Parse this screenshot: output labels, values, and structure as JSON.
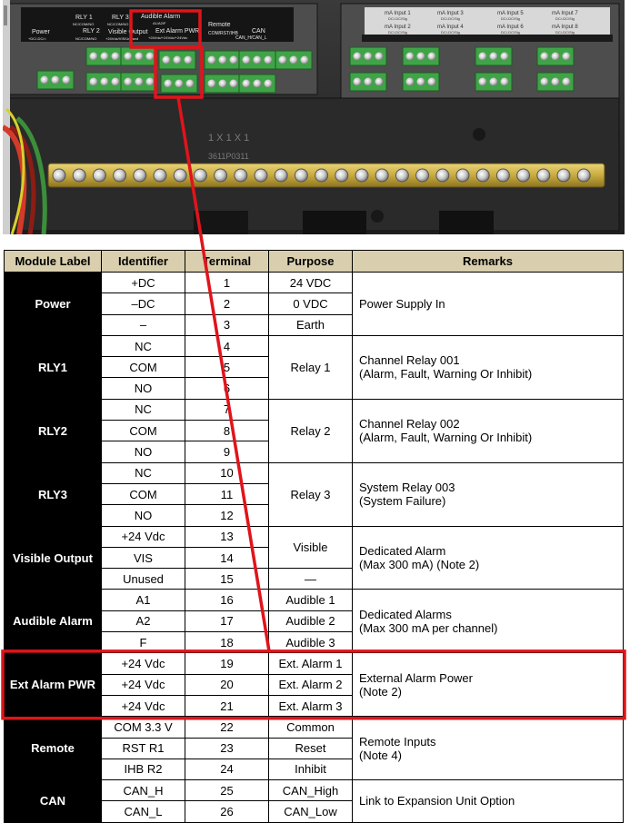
{
  "photo": {
    "labels": {
      "rly1": "RLY 1",
      "rly1_sub": "NC/COM/NO",
      "rly2": "RLY 2",
      "rly2_sub": "NC/COM/NO",
      "rly3": "RLY 3",
      "rly3_sub": "NC/COM/NO",
      "visible_output": "Visible Output",
      "visible_output_sub": "+24Vdc/VIS/Unused",
      "power": "Power",
      "power_sub": "+DC/-DC/=",
      "audible_alarm": "Audible Alarm",
      "audible_alarm_sub": "A1/A2/F",
      "ext_alarm_pwr": "Ext Alarm PWR",
      "ext_alarm_pwr_sub": "+24Vdc/+24Vdc/+24Vdc",
      "remote": "Remote",
      "remote_sub": "COM/RST/IHB",
      "can": "CAN",
      "can_sub": "CAN_H/CAN_L",
      "board_code_1": "1 X 1 X 1",
      "board_code_2": "3611P0311",
      "ma_inputs": [
        {
          "name": "mA Input 1",
          "sub": "DC/-DC/Sig"
        },
        {
          "name": "mA Input 2",
          "sub": "DC/-DC/Sig"
        },
        {
          "name": "mA Input 3",
          "sub": "DC/-DC/Sig"
        },
        {
          "name": "mA Input 4",
          "sub": "DC/-DC/Sig"
        },
        {
          "name": "mA Input 5",
          "sub": "DC/-DC/Sig"
        },
        {
          "name": "mA Input 6",
          "sub": "DC/-DC/Sig"
        },
        {
          "name": "mA Input 7",
          "sub": "DC/-DC/Sig"
        },
        {
          "name": "mA Input 8",
          "sub": "DC/-DC/Sig"
        }
      ]
    }
  },
  "table": {
    "headers": [
      "Module Label",
      "Identifier",
      "Terminal",
      "Purpose",
      "Remarks"
    ],
    "groups": [
      {
        "module": "Power",
        "rows": [
          {
            "identifier": "+DC",
            "terminal": "1",
            "purpose": "24 VDC"
          },
          {
            "identifier": "–DC",
            "terminal": "2",
            "purpose": "0 VDC"
          },
          {
            "identifier": "–",
            "terminal": "3",
            "purpose": "Earth"
          }
        ],
        "purpose_merged": null,
        "remarks": [
          "Power Supply In"
        ]
      },
      {
        "module": "RLY1",
        "rows": [
          {
            "identifier": "NC",
            "terminal": "4"
          },
          {
            "identifier": "COM",
            "terminal": "5"
          },
          {
            "identifier": "NO",
            "terminal": "6"
          }
        ],
        "purpose_merged": "Relay 1",
        "remarks": [
          "Channel Relay 001",
          "(Alarm, Fault, Warning Or Inhibit)"
        ]
      },
      {
        "module": "RLY2",
        "rows": [
          {
            "identifier": "NC",
            "terminal": "7"
          },
          {
            "identifier": "COM",
            "terminal": "8"
          },
          {
            "identifier": "NO",
            "terminal": "9"
          }
        ],
        "purpose_merged": "Relay 2",
        "remarks": [
          "Channel Relay 002",
          "(Alarm, Fault, Warning Or Inhibit)"
        ]
      },
      {
        "module": "RLY3",
        "rows": [
          {
            "identifier": "NC",
            "terminal": "10"
          },
          {
            "identifier": "COM",
            "terminal": "11"
          },
          {
            "identifier": "NO",
            "terminal": "12"
          }
        ],
        "purpose_merged": "Relay 3",
        "remarks": [
          "System Relay 003",
          "(System Failure)"
        ]
      },
      {
        "module": "Visible Output",
        "rows": [
          {
            "identifier": "+24 Vdc",
            "terminal": "13"
          },
          {
            "identifier": "VIS",
            "terminal": "14"
          },
          {
            "identifier": "Unused",
            "terminal": "15",
            "purpose": "—"
          }
        ],
        "purpose_merged_top2": "Visible",
        "remarks": [
          "Dedicated Alarm",
          "(Max 300 mA) (Note 2)"
        ]
      },
      {
        "module": "Audible Alarm",
        "rows": [
          {
            "identifier": "A1",
            "terminal": "16",
            "purpose": "Audible 1"
          },
          {
            "identifier": "A2",
            "terminal": "17",
            "purpose": "Audible 2"
          },
          {
            "identifier": "F",
            "terminal": "18",
            "purpose": "Audible 3"
          }
        ],
        "purpose_merged": null,
        "remarks": [
          "Dedicated Alarms",
          "(Max 300 mA per channel)"
        ]
      },
      {
        "module": "Ext Alarm PWR",
        "highlighted": true,
        "rows": [
          {
            "identifier": "+24 Vdc",
            "terminal": "19",
            "purpose": "Ext. Alarm 1"
          },
          {
            "identifier": "+24 Vdc",
            "terminal": "20",
            "purpose": "Ext. Alarm 2"
          },
          {
            "identifier": "+24 Vdc",
            "terminal": "21",
            "purpose": "Ext. Alarm 3"
          }
        ],
        "purpose_merged": null,
        "remarks": [
          "External Alarm Power",
          "(Note 2)"
        ]
      },
      {
        "module": "Remote",
        "rows": [
          {
            "identifier": "COM 3.3 V",
            "terminal": "22",
            "purpose": "Common"
          },
          {
            "identifier": "RST R1",
            "terminal": "23",
            "purpose": "Reset"
          },
          {
            "identifier": "IHB R2",
            "terminal": "24",
            "purpose": "Inhibit"
          }
        ],
        "purpose_merged": null,
        "remarks": [
          "Remote Inputs",
          "(Note 4)"
        ]
      },
      {
        "module": "CAN",
        "rows": [
          {
            "identifier": "CAN_H",
            "terminal": "25",
            "purpose": "CAN_High"
          },
          {
            "identifier": "CAN_L",
            "terminal": "26",
            "purpose": "CAN_Low"
          }
        ],
        "purpose_merged": null,
        "remarks": [
          "Link to Expansion Unit Option"
        ]
      }
    ]
  },
  "colors": {
    "highlight": "#e0141b",
    "header_bg": "#d9cfae",
    "module_bg": "#000000",
    "terminal_green": "#3fa447"
  }
}
